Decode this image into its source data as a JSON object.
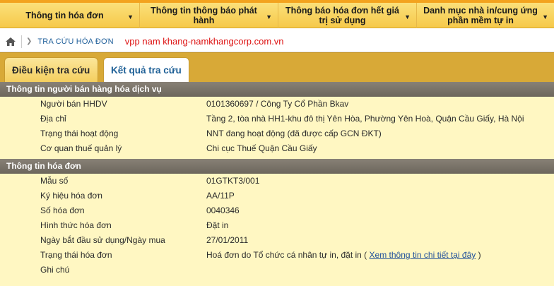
{
  "nav": {
    "items": [
      {
        "label": "Thông tin hóa đơn"
      },
      {
        "label": "Thông tin thông báo phát hành"
      },
      {
        "label": "Thông báo hóa đơn hết giá trị sử dụng"
      },
      {
        "label": "Danh mục nhà in/cung ứng phần mềm tự in"
      }
    ],
    "caret": "▼"
  },
  "breadcrumb": {
    "arrow": "❯",
    "text": "TRA CỨU HÓA ĐƠN",
    "note": "vpp nam khang-namkhangcorp.com.vn"
  },
  "tabs": {
    "condition_label": "Điều kiện tra cứu",
    "result_label": "Kết quả tra cứu"
  },
  "seller": {
    "title": "Thông tin người bán hàng hóa dịch vụ",
    "rows": [
      {
        "label": "Người bán HHDV",
        "value": "0101360697 / Công Ty Cổ Phần Bkav"
      },
      {
        "label": "Địa chỉ",
        "value": "Tầng 2, tòa nhà HH1-khu đô thị Yên Hòa, Phường Yên Hoà, Quận Cầu Giấy, Hà Nội"
      },
      {
        "label": "Trạng thái hoạt động",
        "value": "NNT đang hoạt động (đã được cấp GCN ĐKT)"
      },
      {
        "label": "Cơ quan thuế quản lý",
        "value": "Chi cục Thuế Quận Cầu Giấy"
      }
    ]
  },
  "invoice": {
    "title": "Thông tin hóa đơn",
    "rows": [
      {
        "label": "Mẫu số",
        "value": "01GTKT3/001"
      },
      {
        "label": "Ký hiệu hóa đơn",
        "value": "AA/11P"
      },
      {
        "label": "Số hóa đơn",
        "value": "0040346"
      },
      {
        "label": "Hình thức hóa đơn",
        "value": "Đặt in"
      },
      {
        "label": "Ngày bắt đầu sử dụng/Ngày mua",
        "value": "27/01/2011"
      }
    ],
    "status": {
      "label": "Trạng thái hóa đơn",
      "value_prefix": "Hoá đơn do Tổ chức cá nhân tự in, đặt in (",
      "link": "Xem thông tin chi tiết tại đây",
      "value_suffix": ")"
    },
    "note": {
      "label": "Ghi chú",
      "value": ""
    }
  },
  "colors": {
    "nav_bg": "#f6c94a",
    "tab_bar": "#d8a937",
    "content_bg": "#fff7c2",
    "section_header": "#7a7368",
    "link": "#1f4f9a",
    "note_red": "#dd1111"
  },
  "icons": {
    "home": "home-icon"
  }
}
